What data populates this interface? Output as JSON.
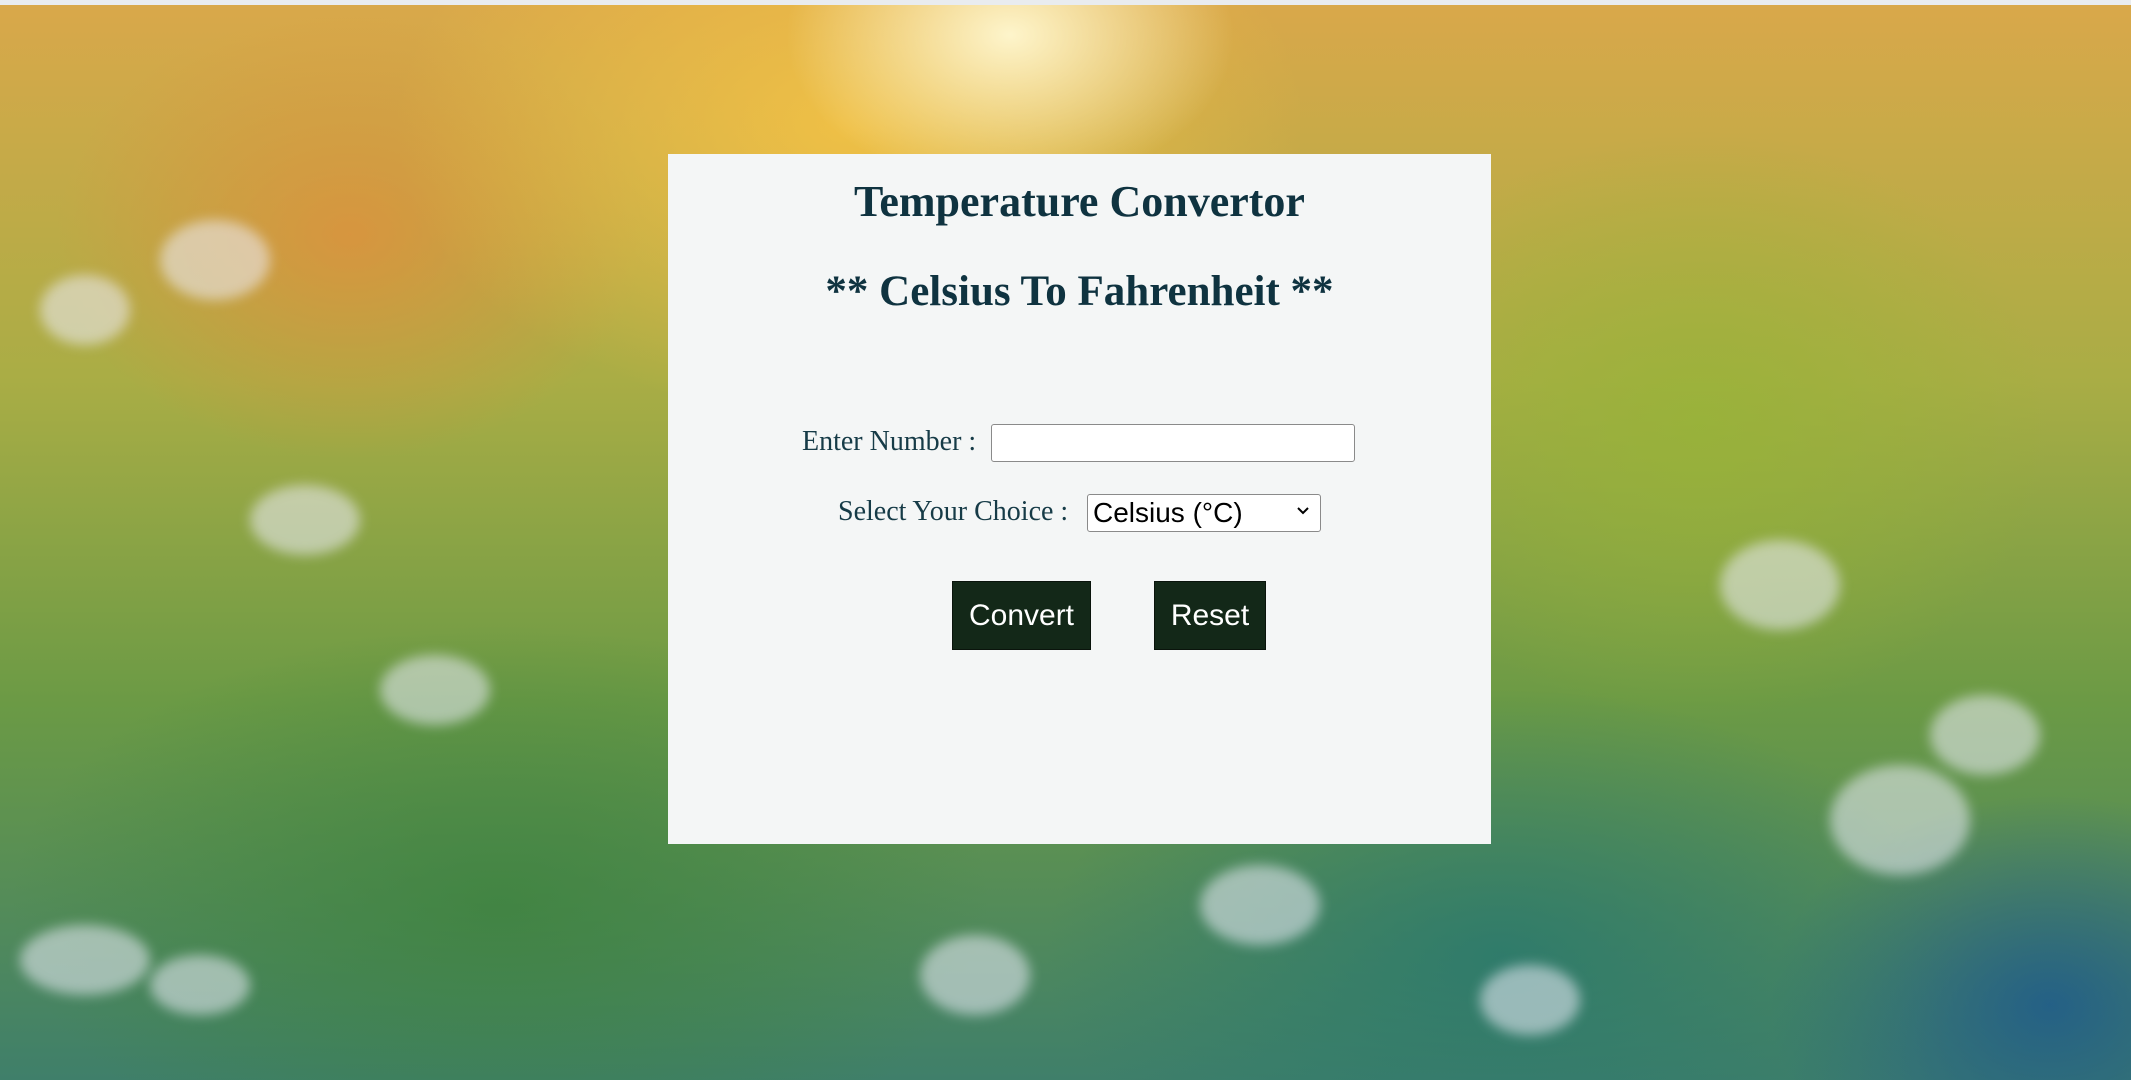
{
  "app": {
    "title": "Temperature Convertor",
    "subtitle": "** Celsius To Fahrenheit **"
  },
  "form": {
    "number_label": "Enter Number :",
    "number_value": "",
    "choice_label": "Select Your Choice :",
    "choice_selected": "Celsius (°C)"
  },
  "buttons": {
    "convert_label": "Convert",
    "reset_label": "Reset"
  },
  "colors": {
    "card_background": "#f4f6f6",
    "heading_text": "#0f3340",
    "button_background": "#132818",
    "button_text": "#ffffff"
  },
  "icons": {
    "select_arrow": "chevron-down-icon"
  }
}
